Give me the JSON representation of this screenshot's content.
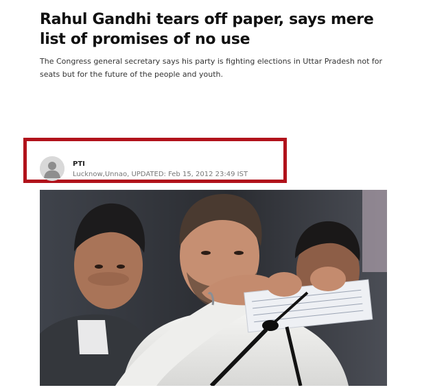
{
  "article": {
    "headline": "Rahul Gandhi tears off paper, says mere list of promises of no use",
    "summary": "The Congress general secretary says his party is fighting elections in Uttar Pradesh not for seats but for the future of the people and youth."
  },
  "byline": {
    "author": "PTI",
    "location": "Lucknow,Unnao,",
    "updated_label": "UPDATED:",
    "updated": "Feb 15, 2012 23:49 IST",
    "avatar_icon": "user-silhouette-icon",
    "highlight_color": "#b1121b"
  },
  "photo": {
    "subject": "news-photo"
  }
}
